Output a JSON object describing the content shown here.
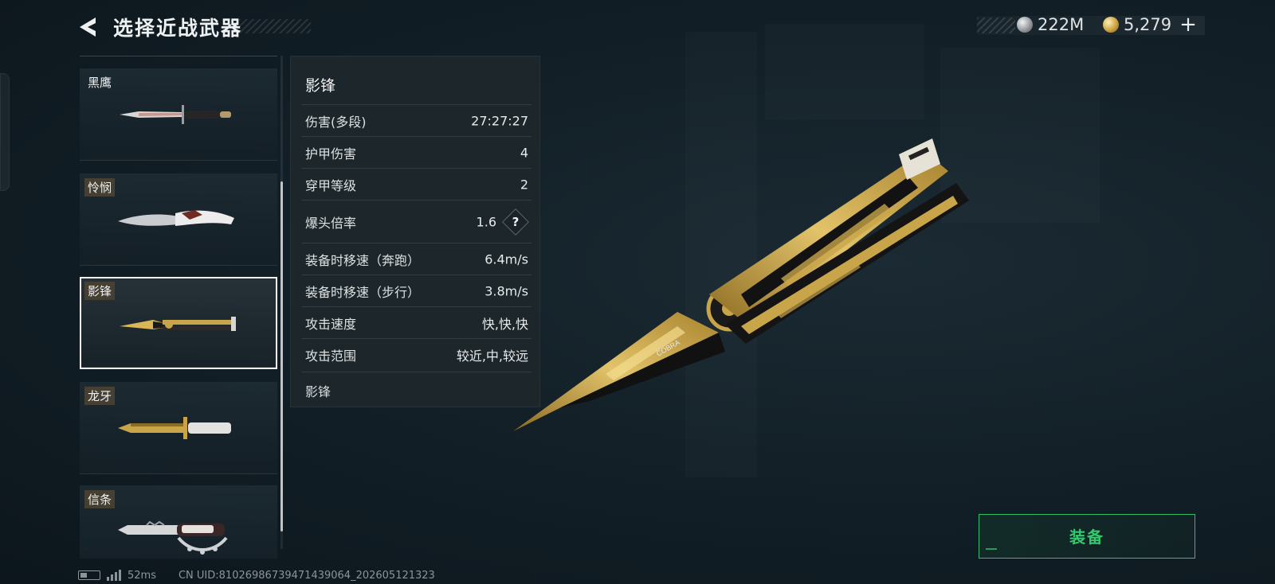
{
  "header": {
    "title": "选择近战武器",
    "currencies": [
      {
        "icon": "silver-coin-icon",
        "value": "222M"
      },
      {
        "icon": "gold-coin-icon",
        "value": "5,279"
      }
    ],
    "add_label": "+"
  },
  "weapon_list": {
    "items": [
      {
        "label": "黑鹰",
        "selected": false,
        "tagged": false,
        "icon": "dagger-icon"
      },
      {
        "label": "怜悯",
        "selected": false,
        "tagged": true,
        "icon": "folding-knife-icon"
      },
      {
        "label": "影锋",
        "selected": true,
        "tagged": true,
        "icon": "butterfly-knife-icon"
      },
      {
        "label": "龙牙",
        "selected": false,
        "tagged": true,
        "icon": "bayonet-icon"
      },
      {
        "label": "信条",
        "selected": false,
        "tagged": true,
        "icon": "knuckle-knife-icon"
      }
    ]
  },
  "stats_panel": {
    "title": "影锋",
    "rows": [
      {
        "label": "伤害(多段)",
        "value": "27:27:27"
      },
      {
        "label": "护甲伤害",
        "value": "4"
      },
      {
        "label": "穿甲等级",
        "value": "2"
      },
      {
        "label": "爆头倍率",
        "value": "1.6",
        "help": "?"
      },
      {
        "label": "装备时移速（奔跑）",
        "value": "6.4m/s"
      },
      {
        "label": "装备时移速（步行）",
        "value": "3.8m/s"
      },
      {
        "label": "攻击速度",
        "value": "快,快,快"
      },
      {
        "label": "攻击范围",
        "value": "较近,中,较远"
      }
    ],
    "description": "影锋"
  },
  "weapon_model": {
    "engraving": "COBRA",
    "accent_color": "#c9a54a"
  },
  "equip_button": {
    "label": "装备",
    "color": "#35c96f"
  },
  "status_bar": {
    "ping": "52ms",
    "uid": "CN UID:81026986739471439064_202605121323"
  }
}
